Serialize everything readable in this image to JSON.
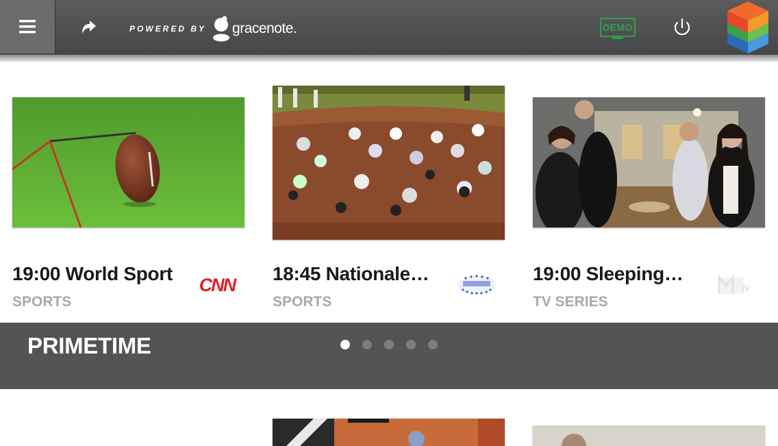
{
  "topbar": {
    "menu_icon": "hamburger-menu-icon",
    "refresh_icon": "refresh-icon",
    "powered_by": "POWERED BY",
    "brand": "gracenote.",
    "demo_label": "DEMO",
    "power_icon": "power-icon",
    "app_logo": "cube-logo-icon",
    "colors": {
      "bar": "#4d4d4f",
      "demo": "#2aa24a"
    }
  },
  "cards": [
    {
      "title": "19:00 World Sport",
      "genre": "SPORTS",
      "channel": "CNN"
    },
    {
      "title": "18:45 Nationale…",
      "genre": "SPORTS",
      "channel": "eurosport-logo"
    },
    {
      "title": "19:00 Sleeping…",
      "genre": "TV SERIES",
      "channel": "mtv-logo"
    }
  ],
  "section": {
    "title": "PRIMETIME",
    "page_count": 5,
    "active_page": 1
  }
}
